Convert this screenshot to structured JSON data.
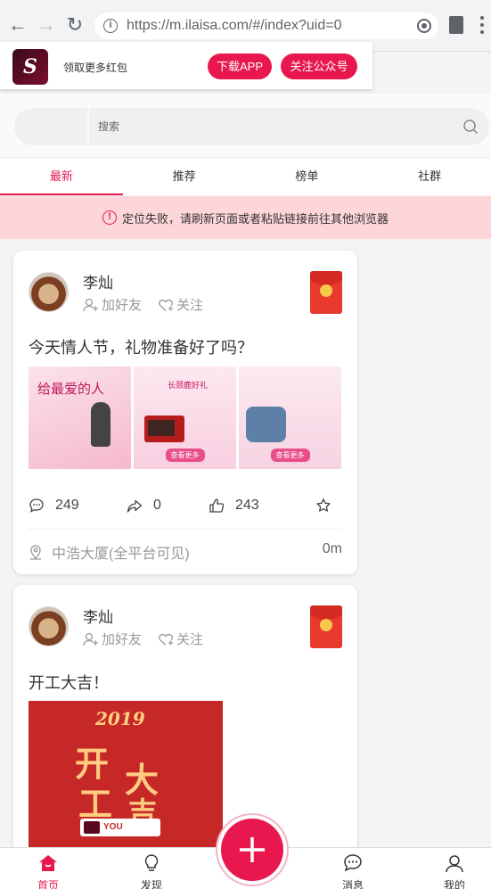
{
  "browser": {
    "url": "https://m.ilaisa.com/#/index?uid=0"
  },
  "promo": {
    "text": "领取更多红包",
    "download_label": "下载APP",
    "follow_label": "关注公众号",
    "logo_letter": "S"
  },
  "search": {
    "placeholder": "搜索"
  },
  "tabs": [
    {
      "label": "最新",
      "active": true
    },
    {
      "label": "推荐"
    },
    {
      "label": "榜单"
    },
    {
      "label": "社群"
    }
  ],
  "alert": {
    "icon": "!",
    "text": "定位失败，请刷新页面或者粘贴链接前往其他浏览器"
  },
  "posts": [
    {
      "username": "李灿",
      "add_friend": "加好友",
      "follow": "关注",
      "text": "今天情人节，礼物准备好了吗？",
      "comments": "249",
      "shares": "0",
      "likes": "243",
      "location": "中浩大厦(全平台可见)",
      "distance": "0m",
      "thumbs": {
        "t1_title": "给最爱的人",
        "t2_title": "长颈鹿好礼",
        "t2_btn": "查看更多",
        "t3_btn": "查看更多"
      }
    },
    {
      "username": "李灿",
      "add_friend": "加好友",
      "follow": "关注",
      "text": "开工大吉！",
      "poster": {
        "year": "2019",
        "c1": "开",
        "c2": "大",
        "c3": "工",
        "c4": "吉",
        "logo": "YOU"
      }
    }
  ],
  "bottom_nav": [
    {
      "label": "首页",
      "active": true
    },
    {
      "label": "发现"
    },
    {
      "label": "消息"
    },
    {
      "label": "我的"
    }
  ],
  "colors": {
    "accent": "#e8184f",
    "alert_bg": "#fcd6d9"
  }
}
